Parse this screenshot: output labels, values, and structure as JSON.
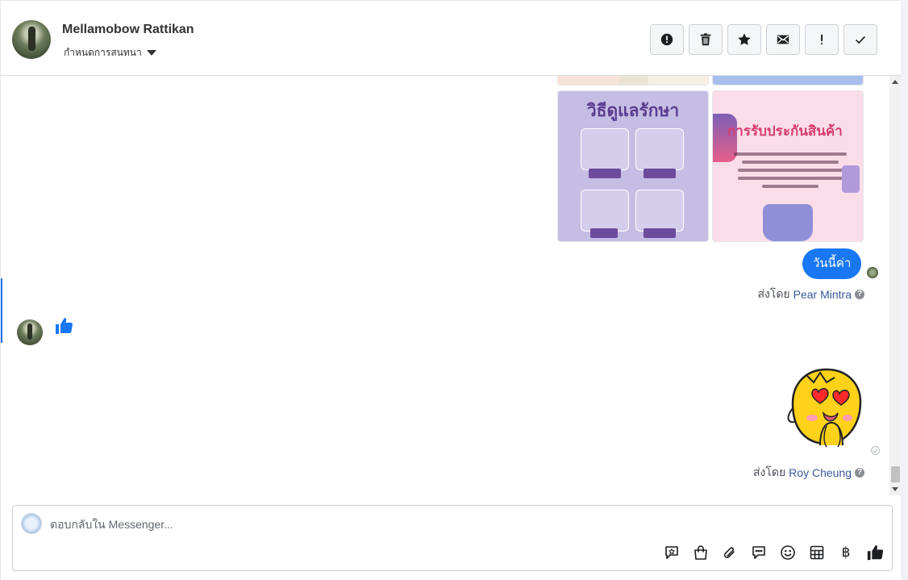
{
  "header": {
    "contact_name": "Mellamobow Rattikan",
    "conversation_settings": "กำหนดการสนทนา",
    "actions": [
      {
        "name": "mark-spam-button",
        "icon": "alert-circle-icon"
      },
      {
        "name": "delete-button",
        "icon": "trash-icon"
      },
      {
        "name": "star-button",
        "icon": "star-icon"
      },
      {
        "name": "mark-unread-button",
        "icon": "envelope-icon"
      },
      {
        "name": "follow-up-button",
        "icon": "exclamation-icon"
      },
      {
        "name": "mark-done-button",
        "icon": "check-icon"
      }
    ]
  },
  "messages": {
    "outgoing_text": "วันนี้ค่า",
    "sent_by_label_1": "ส่งโดย",
    "sent_by_name_1": "Pear Mintra",
    "sent_by_label_2": "ส่งโดย",
    "sent_by_name_2": "Roy Cheung",
    "incoming_like": "thumbs-up-icon",
    "care_image_title": "วิธีดูแลรักษา",
    "warranty_image_title": "การรับประกันสินค้า"
  },
  "composer": {
    "placeholder": "ตอบกลับใน Messenger...",
    "tools": [
      "saved-reply-icon",
      "shop-bag-icon",
      "attachment-icon",
      "comment-icon",
      "emoji-icon",
      "table-icon",
      "baht-icon",
      "thumbs-up-icon"
    ],
    "baht_symbol": "฿"
  },
  "colors": {
    "accent": "#1877f2",
    "sent_by_name": "#385898"
  }
}
